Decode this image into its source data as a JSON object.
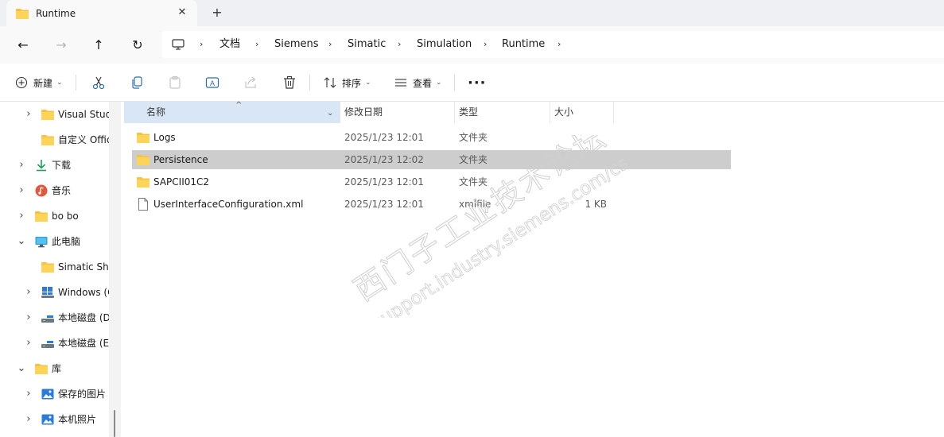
{
  "window": {
    "tab_title": "Runtime",
    "close_glyph": "✕",
    "new_tab_glyph": "+"
  },
  "nav": {
    "back_glyph": "←",
    "forward_glyph": "→",
    "up_glyph": "↑",
    "refresh_glyph": "↻"
  },
  "breadcrumb": {
    "separator": "›",
    "items": [
      "文档",
      "Siemens",
      "Simatic",
      "Simulation",
      "Runtime"
    ]
  },
  "toolbar": {
    "new_label": "新建",
    "sort_label": "排序",
    "view_label": "查看",
    "more_glyph": "···"
  },
  "sidebar": {
    "items": [
      {
        "label": "Visual Studio",
        "icon": "folder-icon"
      },
      {
        "label": "自定义 Office",
        "icon": "folder-icon"
      },
      {
        "label": "下载",
        "icon": "download-icon"
      },
      {
        "label": "音乐",
        "icon": "music-icon"
      },
      {
        "label": "bo bo",
        "icon": "folder-icon"
      },
      {
        "label": "此电脑",
        "icon": "monitor-icon"
      },
      {
        "label": "Simatic Shell",
        "icon": "folder-icon"
      },
      {
        "label": "Windows (C:)",
        "icon": "drive-icon"
      },
      {
        "label": "本地磁盘 (D:)",
        "icon": "drive-icon"
      },
      {
        "label": "本地磁盘 (E:)",
        "icon": "drive-icon"
      },
      {
        "label": "库",
        "icon": "folder-icon"
      },
      {
        "label": "保存的图片",
        "icon": "picture-icon"
      },
      {
        "label": "本机照片",
        "icon": "picture-icon"
      }
    ]
  },
  "columns": {
    "name": "名称",
    "date": "修改日期",
    "type": "类型",
    "size": "大小"
  },
  "files": [
    {
      "name": "Logs",
      "date": "2025/1/23 12:01",
      "type": "文件夹",
      "size": "",
      "icon": "folder-icon"
    },
    {
      "name": "Persistence",
      "date": "2025/1/23 12:02",
      "type": "文件夹",
      "size": "",
      "icon": "folder-icon"
    },
    {
      "name": "SAPCII01C2",
      "date": "2025/1/23 12:01",
      "type": "文件夹",
      "size": "",
      "icon": "folder-icon"
    },
    {
      "name": "UserInterfaceConfiguration.xml",
      "date": "2025/1/23 12:01",
      "type": "xmlfile",
      "size": "1 KB",
      "icon": "document-icon"
    }
  ],
  "watermark": {
    "line1": "西门子工业技术论坛",
    "line2": "support.industry.siemens.com/cs"
  },
  "colors": {
    "folder": "#f5c242",
    "selected_row": "#cdcdcd",
    "header_selected": "#d8e6f5",
    "accent": "#0067c0"
  }
}
